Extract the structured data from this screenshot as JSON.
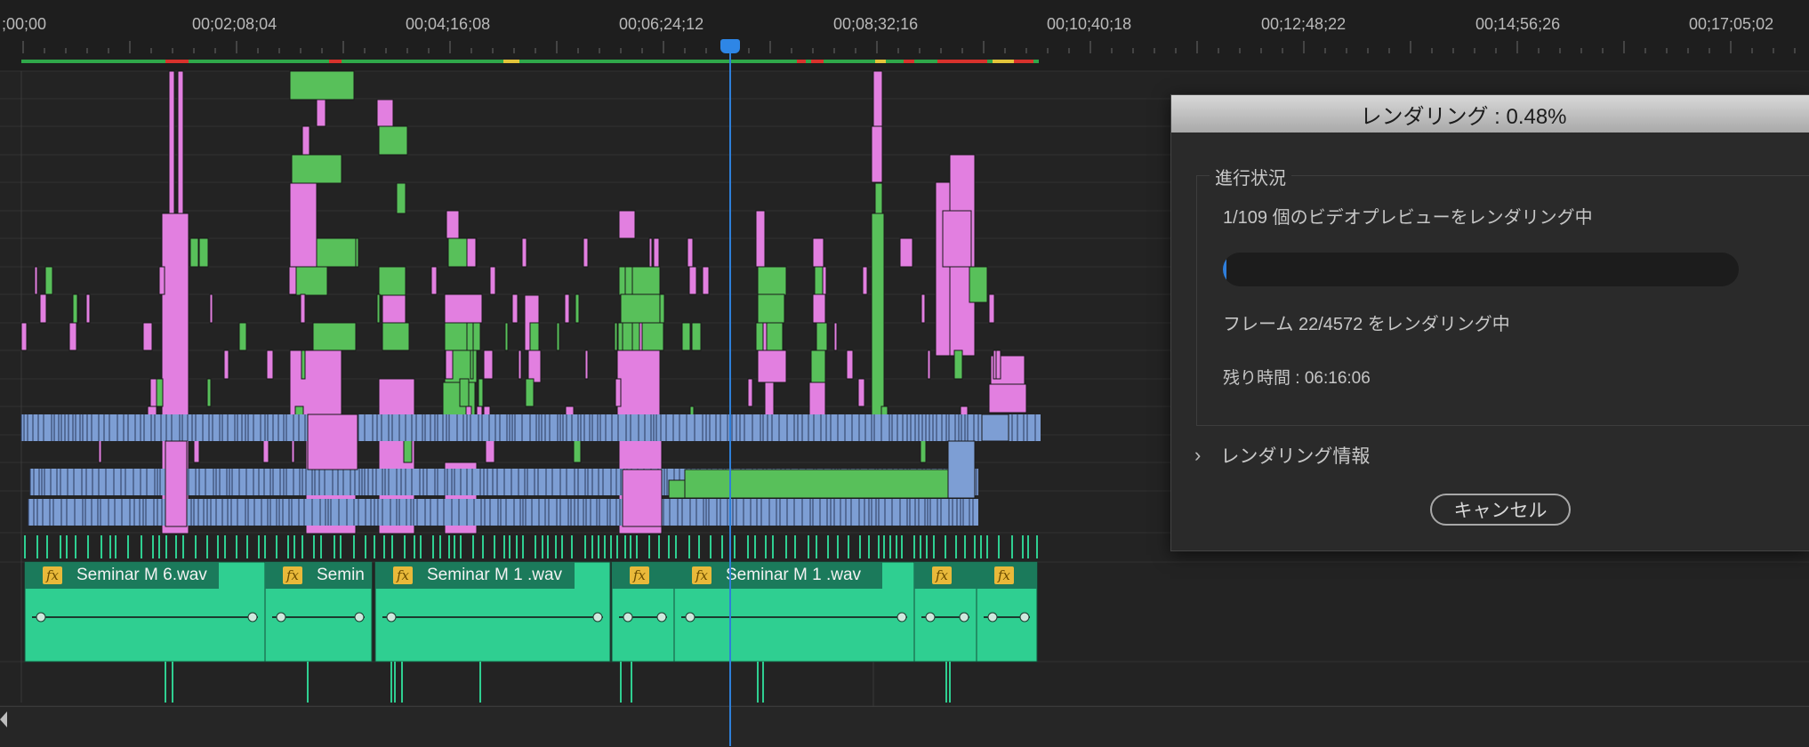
{
  "ruler": {
    "timecodes": [
      ";00;00",
      "00;02;08;04",
      "00;04;16;08",
      "00;06;24;12",
      "00;08;32;16",
      "00;10;40;18",
      "00;12;48;22",
      "00;14;56;26",
      "00;17;05;02"
    ]
  },
  "colors": {
    "background": "#232323",
    "clip_pink": "#e27fe0",
    "clip_green": "#58c05a",
    "clip_blue": "#7d9ed4",
    "audio_clip": "#2fcf91",
    "audio_header": "#1b7a5b",
    "playhead": "#2e86e6",
    "render_bar_green": "#2fa84a",
    "render_bar_red": "#d8322c",
    "render_bar_yellow": "#e3c43a"
  },
  "audio_clips": [
    {
      "name": "Seminar M 6.wav",
      "fx": "fx"
    },
    {
      "name": "Semin",
      "fx": "fx"
    },
    {
      "name": "Seminar M 1 .wav",
      "fx": "fx"
    },
    {
      "name": "",
      "fx": "fx"
    },
    {
      "name": "Seminar M 1 .wav",
      "fx": "fx"
    },
    {
      "name": "",
      "fx": "fx"
    },
    {
      "name": "",
      "fx": "fx"
    }
  ],
  "dialog": {
    "title": "レンダリング : 0.48%",
    "progress_group_label": "進行状況",
    "status_line": "1/109 個のビデオプレビューをレンダリング中",
    "progress": 0.0048,
    "frame_line": "フレーム 22/4572 をレンダリング中",
    "remaining_line": "残り時間 : 06:16:06",
    "render_info_label": "レンダリング情報",
    "render_info_chevron": "›",
    "cancel_label": "キャンセル"
  }
}
